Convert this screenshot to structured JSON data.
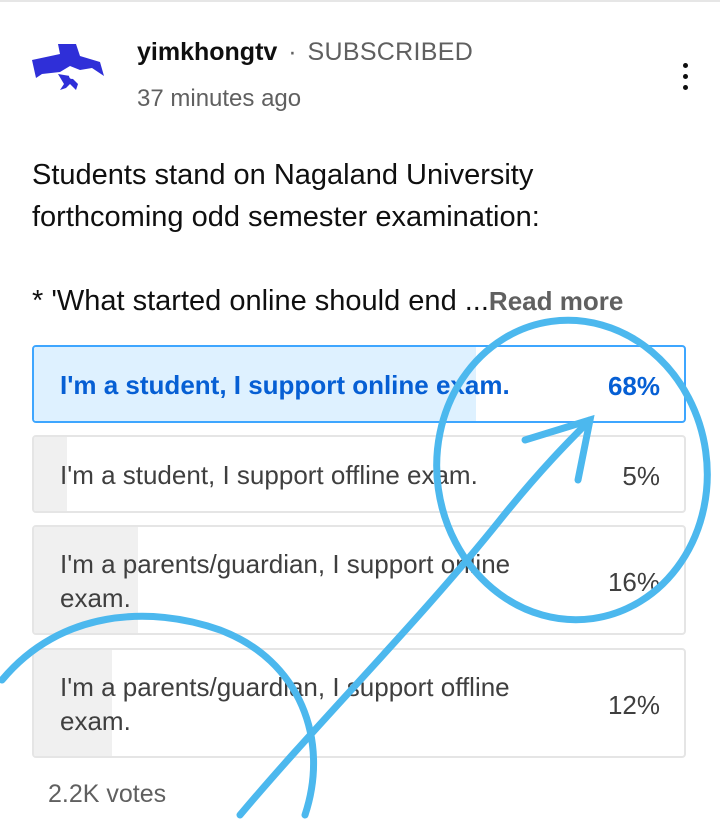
{
  "post": {
    "channel_name": "yimkhongtv",
    "separator": "·",
    "subscription_status": "SUBSCRIBED",
    "time_ago": "37 minutes ago",
    "text_line1": "Students stand on Nagaland University",
    "text_line2": "forthcoming odd semester examination:",
    "text_line3": "* 'What started online should end ...",
    "read_more": "Read more"
  },
  "poll": {
    "options": [
      {
        "label": "I'm a student, I support online exam.",
        "percent": "68%",
        "fraction": 0.68,
        "selected": true
      },
      {
        "label": "I'm a student, I support offline exam.",
        "percent": "5%",
        "fraction": 0.05,
        "selected": false
      },
      {
        "label": "I'm a parents/guardian, I support online exam.",
        "percent": "16%",
        "fraction": 0.16,
        "selected": false
      },
      {
        "label": "I'm a parents/guardian, I support offline exam.",
        "percent": "12%",
        "fraction": 0.12,
        "selected": false
      }
    ],
    "votes": "2.2K votes"
  },
  "colors": {
    "accent_blue": "#065fd4",
    "selected_border": "#3ea6ff",
    "selected_fill": "#def1ff",
    "annotation_cyan": "#4cb8ee",
    "logo_blue": "#2f2fd8"
  },
  "icons": {
    "logo": "channel-logo-icon",
    "menu": "more-vertical-icon"
  }
}
